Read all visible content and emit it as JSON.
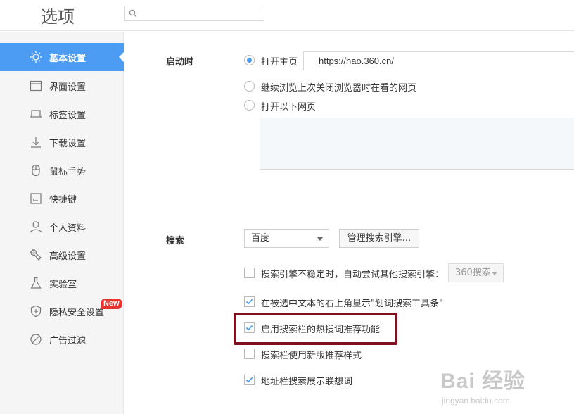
{
  "header": {
    "title": "选项",
    "search": {
      "value": "",
      "placeholder": ""
    }
  },
  "sidebar": {
    "items": [
      {
        "label": "基本设置",
        "icon": "sun-icon",
        "active": true
      },
      {
        "label": "界面设置",
        "icon": "window-icon"
      },
      {
        "label": "标签设置",
        "icon": "tab-icon"
      },
      {
        "label": "下载设置",
        "icon": "download-icon"
      },
      {
        "label": "鼠标手势",
        "icon": "mouse-icon"
      },
      {
        "label": "快捷键",
        "icon": "keyboard-icon"
      },
      {
        "label": "个人资料",
        "icon": "user-icon"
      },
      {
        "label": "高级设置",
        "icon": "wrench-icon"
      },
      {
        "label": "实验室",
        "icon": "flask-icon"
      },
      {
        "label": "隐私安全设置",
        "icon": "shield-icon",
        "badge": "New"
      },
      {
        "label": "广告过滤",
        "icon": "block-icon"
      }
    ]
  },
  "startup": {
    "label": "启动时",
    "options": [
      {
        "label": "打开主页",
        "checked": true
      },
      {
        "label": "继续浏览上次关闭浏览器时在看的网页",
        "checked": false
      },
      {
        "label": "打开以下网页",
        "checked": false
      }
    ],
    "homepage_url": "https://hao.360.cn/"
  },
  "search": {
    "label": "搜索",
    "engine_selected": "百度",
    "manage_button": "管理搜索引擎...",
    "checkboxes": [
      {
        "label": "搜索引擎不稳定时，自动尝试其他搜索引擎：",
        "checked": false
      },
      {
        "label": "在被选中文本的右上角显示\"划词搜索工具条\"",
        "checked": true
      },
      {
        "label": "启用搜索栏的热搜词推荐功能",
        "checked": true
      },
      {
        "label": "搜索栏使用新版推荐样式",
        "checked": false
      },
      {
        "label": "地址栏搜索展示联想词",
        "checked": true
      }
    ],
    "fallback_engine": "360搜索"
  },
  "watermark": {
    "brand": "Bai 经验",
    "site": "jingyan.baidu.com"
  },
  "colors": {
    "accent": "#4c9cf4",
    "highlight_border": "#7f1020",
    "badge": "#e8322b"
  }
}
